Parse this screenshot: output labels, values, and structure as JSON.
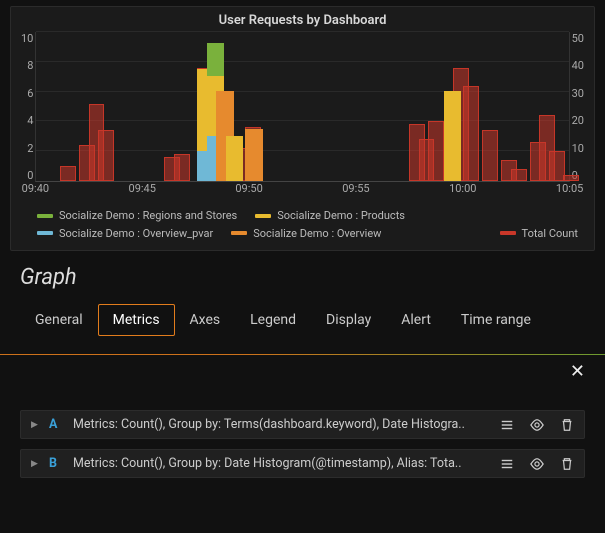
{
  "chart_data": {
    "type": "bar",
    "title": "User Requests by Dashboard",
    "xlabel": "",
    "ylabel_left": "",
    "ylabel_right": "",
    "left_axis": {
      "min": 0,
      "max": 10,
      "ticks": [
        0,
        2,
        4,
        6,
        8,
        10
      ]
    },
    "right_axis": {
      "min": 0,
      "max": 50,
      "ticks": [
        0,
        10,
        20,
        30,
        40,
        50
      ]
    },
    "x_ticks": [
      "09:40",
      "09:45",
      "09:50",
      "09:55",
      "10:00",
      "10:05"
    ],
    "series_left": [
      {
        "name": "Socialize Demo : Regions and Stores",
        "color": "#7ab13c"
      },
      {
        "name": "Socialize Demo : Products",
        "color": "#e8bb2f"
      },
      {
        "name": "Socialize Demo : Overview_pvar",
        "color": "#6fb8d6"
      },
      {
        "name": "Socialize Demo : Overview",
        "color": "#e68a2e"
      }
    ],
    "series_right": [
      {
        "name": "Total Count",
        "color": "#c93729"
      }
    ],
    "stacked_segments": [
      {
        "t": "09:48:00",
        "x_pct": 30.2,
        "segs": [
          {
            "series": 2,
            "v": 2
          },
          {
            "series": 1,
            "v": 5.5
          },
          {
            "series": 0,
            "v": 0
          }
        ]
      },
      {
        "t": "09:48:30",
        "x_pct": 32.0,
        "segs": [
          {
            "series": 2,
            "v": 3
          },
          {
            "series": 1,
            "v": 4
          },
          {
            "series": 0,
            "v": 2.2
          }
        ]
      },
      {
        "t": "09:49:00",
        "x_pct": 33.8,
        "segs": [
          {
            "series": 3,
            "v": 6
          }
        ]
      },
      {
        "t": "09:49:30",
        "x_pct": 35.6,
        "segs": [
          {
            "series": 1,
            "v": 3
          }
        ]
      },
      {
        "t": "09:50:30",
        "x_pct": 39.2,
        "segs": [
          {
            "series": 3,
            "v": 3.5
          }
        ]
      },
      {
        "t": "10:00:30",
        "x_pct": 76.5,
        "segs": [
          {
            "series": 1,
            "v": 6
          }
        ]
      }
    ],
    "right_bars": [
      {
        "t": "09:41:00",
        "x_pct": 4.5,
        "v": 5
      },
      {
        "t": "09:42:00",
        "x_pct": 8.0,
        "v": 12
      },
      {
        "t": "09:42:30",
        "x_pct": 9.8,
        "v": 26
      },
      {
        "t": "09:43:00",
        "x_pct": 11.6,
        "v": 17
      },
      {
        "t": "09:46:30",
        "x_pct": 24.0,
        "v": 8
      },
      {
        "t": "09:47:00",
        "x_pct": 25.8,
        "v": 9
      },
      {
        "t": "09:48:00",
        "x_pct": 30.2,
        "v": 38
      },
      {
        "t": "09:48:30",
        "x_pct": 32.0,
        "v": 46
      },
      {
        "t": "09:49:00",
        "x_pct": 33.8,
        "v": 30
      },
      {
        "t": "09:49:30",
        "x_pct": 35.6,
        "v": 15
      },
      {
        "t": "09:50:00",
        "x_pct": 37.4,
        "v": 11
      },
      {
        "t": "09:50:30",
        "x_pct": 39.2,
        "v": 18
      },
      {
        "t": "09:59:00",
        "x_pct": 70.0,
        "v": 19
      },
      {
        "t": "09:59:30",
        "x_pct": 71.8,
        "v": 14
      },
      {
        "t": "10:00:00",
        "x_pct": 73.6,
        "v": 20
      },
      {
        "t": "10:00:30",
        "x_pct": 76.5,
        "v": 30
      },
      {
        "t": "10:01:00",
        "x_pct": 78.3,
        "v": 38
      },
      {
        "t": "10:01:30",
        "x_pct": 80.1,
        "v": 32
      },
      {
        "t": "10:02:30",
        "x_pct": 83.7,
        "v": 17
      },
      {
        "t": "10:03:30",
        "x_pct": 87.3,
        "v": 7
      },
      {
        "t": "10:04:00",
        "x_pct": 89.1,
        "v": 4
      },
      {
        "t": "10:05:00",
        "x_pct": 92.7,
        "v": 13
      },
      {
        "t": "10:05:30",
        "x_pct": 94.5,
        "v": 22
      },
      {
        "t": "10:06:00",
        "x_pct": 96.3,
        "v": 10
      },
      {
        "t": "10:07:00",
        "x_pct": 99.0,
        "v": 2
      }
    ]
  },
  "editor": {
    "title": "Graph",
    "tabs": [
      "General",
      "Metrics",
      "Axes",
      "Legend",
      "Display",
      "Alert",
      "Time range"
    ],
    "active_tab": 1,
    "close_label": "✕"
  },
  "queries": [
    {
      "letter": "A",
      "summary": "Metrics: Count(), Group by: Terms(dashboard.keyword), Date Histogra.."
    },
    {
      "letter": "B",
      "summary": "Metrics: Count(), Group by: Date Histogram(@timestamp), Alias: Tota.."
    }
  ]
}
